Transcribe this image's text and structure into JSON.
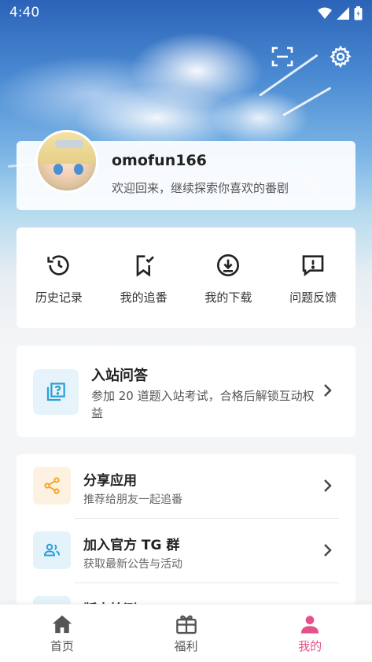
{
  "status_bar": {
    "time": "4:40"
  },
  "profile": {
    "username": "omofun166",
    "greeting": "欢迎回来，继续探索你喜欢的番剧"
  },
  "quick_actions": [
    {
      "label": "历史记录",
      "icon": "history-icon"
    },
    {
      "label": "我的追番",
      "icon": "bookmark-check-icon"
    },
    {
      "label": "我的下载",
      "icon": "download-icon"
    },
    {
      "label": "问题反馈",
      "icon": "feedback-icon"
    }
  ],
  "entrance_quiz": {
    "title": "入站问答",
    "description": "参加 20 道题入站考试，合格后解锁互动权益",
    "icon": "quiz-icon"
  },
  "menu": [
    {
      "title": "分享应用",
      "subtitle": "推荐给朋友一起追番",
      "icon": "share-icon",
      "color": "#f5a524",
      "bg": "#fdf1e1"
    },
    {
      "title": "加入官方 TG 群",
      "subtitle": "获取最新公告与活动",
      "icon": "group-icon",
      "color": "#2aa0d8",
      "bg": "#e4f3fa"
    },
    {
      "title": "版本检测",
      "subtitle": "",
      "icon": "version-icon",
      "color": "#2aa0d8",
      "bg": "#e4f3fa"
    }
  ],
  "bottom_nav": [
    {
      "label": "首页",
      "icon": "home-icon",
      "active": false
    },
    {
      "label": "福利",
      "icon": "gift-icon",
      "active": false
    },
    {
      "label": "我的",
      "icon": "user-icon",
      "active": true
    }
  ],
  "colors": {
    "accent": "#e5528a",
    "info": "#2aa0d8",
    "warning": "#f5a524"
  }
}
